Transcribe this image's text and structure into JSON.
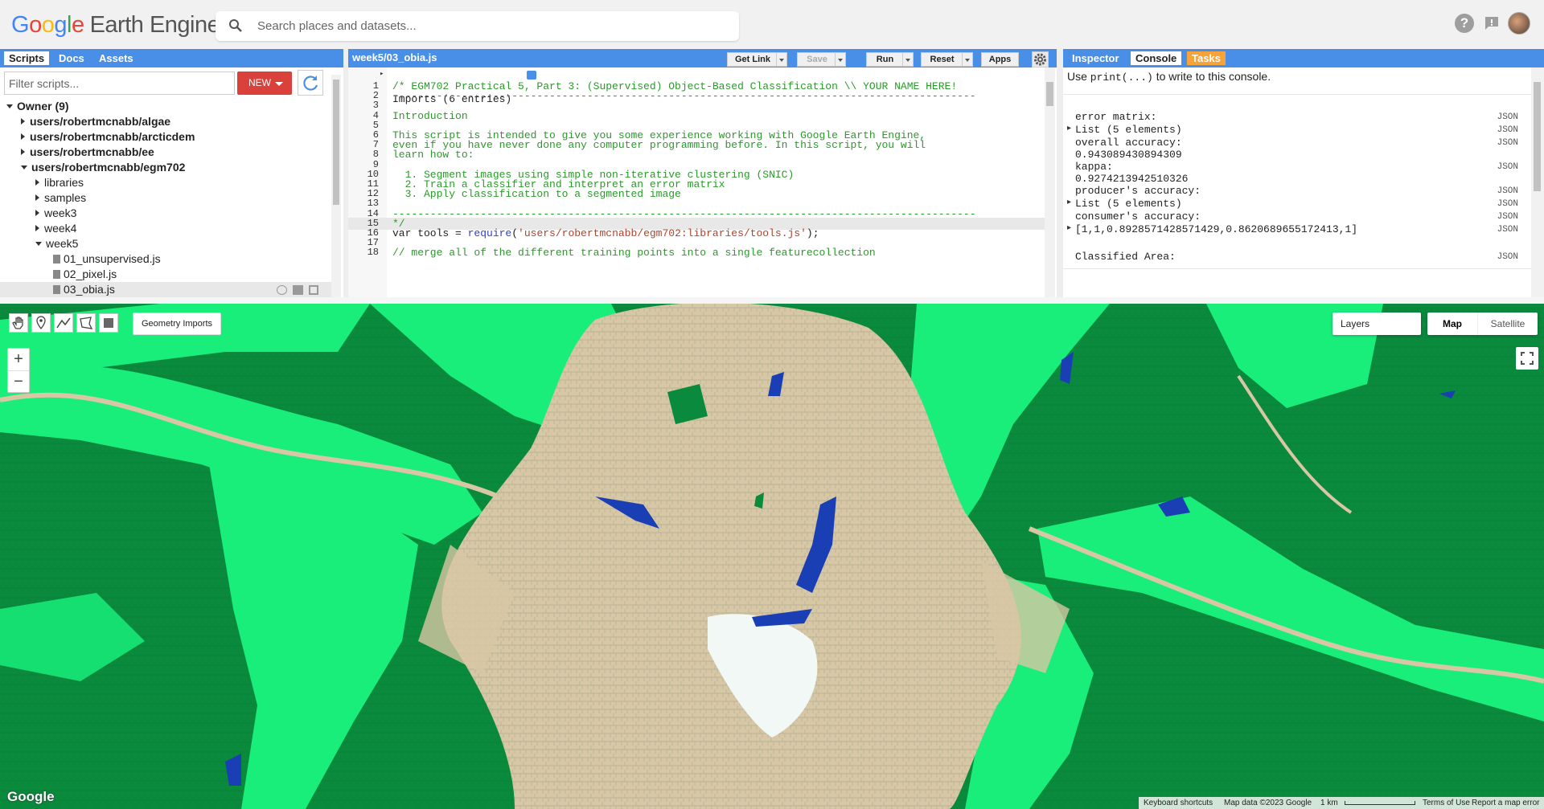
{
  "app": {
    "logo_parts": [
      "G",
      "o",
      "o",
      "g",
      "l",
      "e"
    ],
    "logo_product": "Earth Engine"
  },
  "search": {
    "placeholder": "Search places and datasets..."
  },
  "left_panel": {
    "tabs": [
      "Scripts",
      "Docs",
      "Assets"
    ],
    "filter_placeholder": "Filter scripts...",
    "new_label": "NEW",
    "tree": [
      {
        "label": "Owner (9)",
        "indent": 0,
        "open": true,
        "bold": true
      },
      {
        "label": "users/robertmcnabb/algae",
        "indent": 1,
        "open": false,
        "bold": true
      },
      {
        "label": "users/robertmcnabb/arcticdem",
        "indent": 1,
        "open": false,
        "bold": true
      },
      {
        "label": "users/robertmcnabb/ee",
        "indent": 1,
        "open": false,
        "bold": true
      },
      {
        "label": "users/robertmcnabb/egm702",
        "indent": 1,
        "open": true,
        "bold": true
      },
      {
        "label": "libraries",
        "indent": 2,
        "open": false
      },
      {
        "label": "samples",
        "indent": 2,
        "open": false
      },
      {
        "label": "week3",
        "indent": 2,
        "open": false
      },
      {
        "label": "week4",
        "indent": 2,
        "open": false
      },
      {
        "label": "week5",
        "indent": 2,
        "open": true
      },
      {
        "label": "01_unsupervised.js",
        "indent": 3,
        "file": true
      },
      {
        "label": "02_pixel.js",
        "indent": 3,
        "file": true
      },
      {
        "label": "03_obia.js",
        "indent": 3,
        "file": true,
        "selected": true
      }
    ]
  },
  "editor": {
    "title": "week5/03_obia.js",
    "buttons": {
      "get_link": "Get Link",
      "save": "Save",
      "run": "Run",
      "reset": "Reset",
      "apps": "Apps"
    },
    "imports_label": "Imports (6 entries)",
    "lines": [
      {
        "n": "1",
        "t": "/* EGM702 Practical 5, Part 3: (Supervised) Object-Based Classification \\\\ YOUR NAME HERE!",
        "c": "cm"
      },
      {
        "n": "2",
        "t": "---------------------------------------------------------------------------------------------",
        "c": "cm"
      },
      {
        "n": "3",
        "t": "",
        "c": "cm"
      },
      {
        "n": "4",
        "t": "Introduction",
        "c": "cm"
      },
      {
        "n": "5",
        "t": "",
        "c": "cm"
      },
      {
        "n": "6",
        "t": "This script is intended to give you some experience working with Google Earth Engine,",
        "c": "cm"
      },
      {
        "n": "7",
        "t": "even if you have never done any computer programming before. In this script, you will",
        "c": "cm"
      },
      {
        "n": "8",
        "t": "learn how to:",
        "c": "cm"
      },
      {
        "n": "9",
        "t": "",
        "c": "cm"
      },
      {
        "n": "10",
        "t": "  1. Segment images using simple non-iterative clustering (SNIC)",
        "c": "cm"
      },
      {
        "n": "11",
        "t": "  2. Train a classifier and interpret an error matrix",
        "c": "cm"
      },
      {
        "n": "12",
        "t": "  3. Apply classification to a segmented image",
        "c": "cm"
      },
      {
        "n": "13",
        "t": "",
        "c": "cm"
      },
      {
        "n": "14",
        "t": "---------------------------------------------------------------------------------------------",
        "c": "cm"
      },
      {
        "n": "15",
        "t": "*/",
        "c": "cm"
      },
      {
        "n": "16",
        "t": "",
        "c": "code"
      },
      {
        "n": "17",
        "t": "",
        "c": "code"
      },
      {
        "n": "18",
        "t": "// merge all of the different training points into a single featurecollection",
        "c": "cm"
      }
    ],
    "line16": {
      "pre": "var tools = ",
      "fn": "require",
      "open": "(",
      "str": "'users/robertmcnabb/egm702:libraries/tools.js'",
      "post": ");"
    }
  },
  "right_panel": {
    "tabs": [
      "Inspector",
      "Console",
      "Tasks"
    ],
    "hint_pre": "Use ",
    "hint_code": "print(...)",
    "hint_post": " to write to this console.",
    "json_label": "JSON",
    "rows": [
      {
        "text": "error matrix:",
        "mono": true
      },
      {
        "text": "List (5 elements)",
        "mono": true,
        "expand": true
      },
      {
        "text": "overall accuracy:",
        "mono": true
      },
      {
        "text": "0.943089430894309",
        "mono": true
      },
      {
        "text": "kappa:",
        "mono": true
      },
      {
        "text": "0.9274213942510326",
        "mono": true
      },
      {
        "text": "producer's accuracy:",
        "mono": true
      },
      {
        "text": "List (5 elements)",
        "mono": true,
        "expand": true
      },
      {
        "text": "consumer's accuracy:",
        "mono": true
      },
      {
        "text": "[1,1,0.8928571428571429,0.8620689655172413,1]",
        "mono": true,
        "expand": true
      },
      {
        "text": "Classified Area:",
        "mono": true
      }
    ]
  },
  "map": {
    "geometry_imports": "Geometry Imports",
    "layers_label": "Layers",
    "map_type": [
      "Map",
      "Satellite"
    ],
    "watermark": "Google",
    "attribution": {
      "shortcuts": "Keyboard shortcuts",
      "data": "Map data ©2023 Google",
      "scale": "1 km",
      "terms": "Terms of Use",
      "report": "Report a map error"
    },
    "colors": {
      "forest": "#0a8a3c",
      "grass": "#19ed7a",
      "bare": "#d8c7a4",
      "water": "#1a3fb5",
      "snow": "#f2f8f6"
    }
  }
}
